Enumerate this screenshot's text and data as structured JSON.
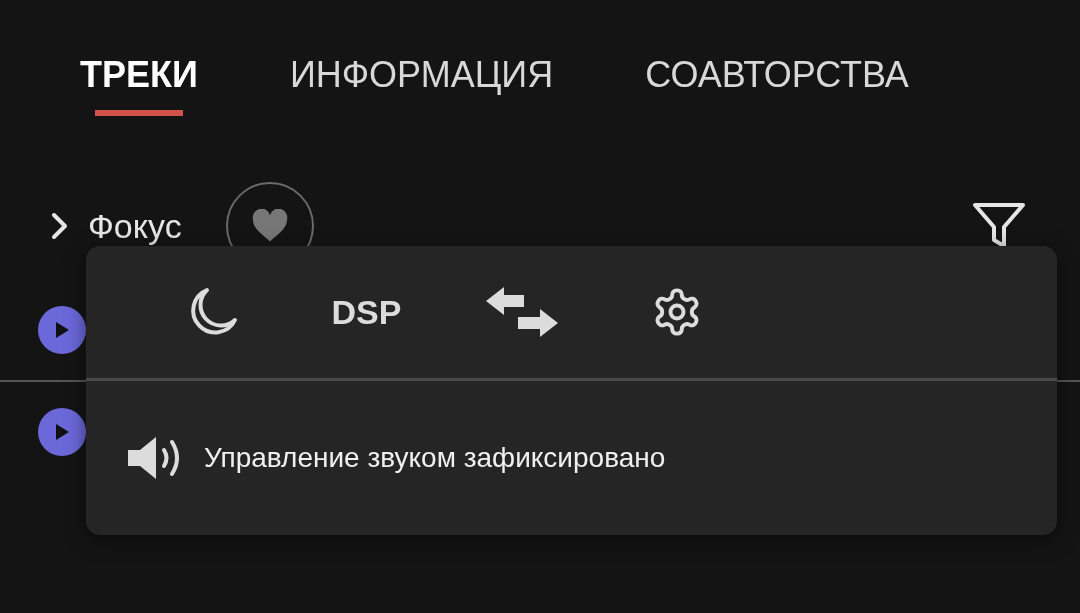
{
  "tabs": [
    {
      "label": "ТРЕКИ",
      "selected": true
    },
    {
      "label": "ИНФОРМАЦИЯ",
      "selected": false
    },
    {
      "label": "СОАВТОРСТВА",
      "selected": false
    }
  ],
  "focus": {
    "label": "Фокус",
    "expanded": false
  },
  "popover": {
    "tools": [
      {
        "kind": "moon"
      },
      {
        "kind": "text",
        "label": "DSP"
      },
      {
        "kind": "swap"
      },
      {
        "kind": "gear"
      }
    ],
    "message": "Управление звуком зафиксировано"
  }
}
